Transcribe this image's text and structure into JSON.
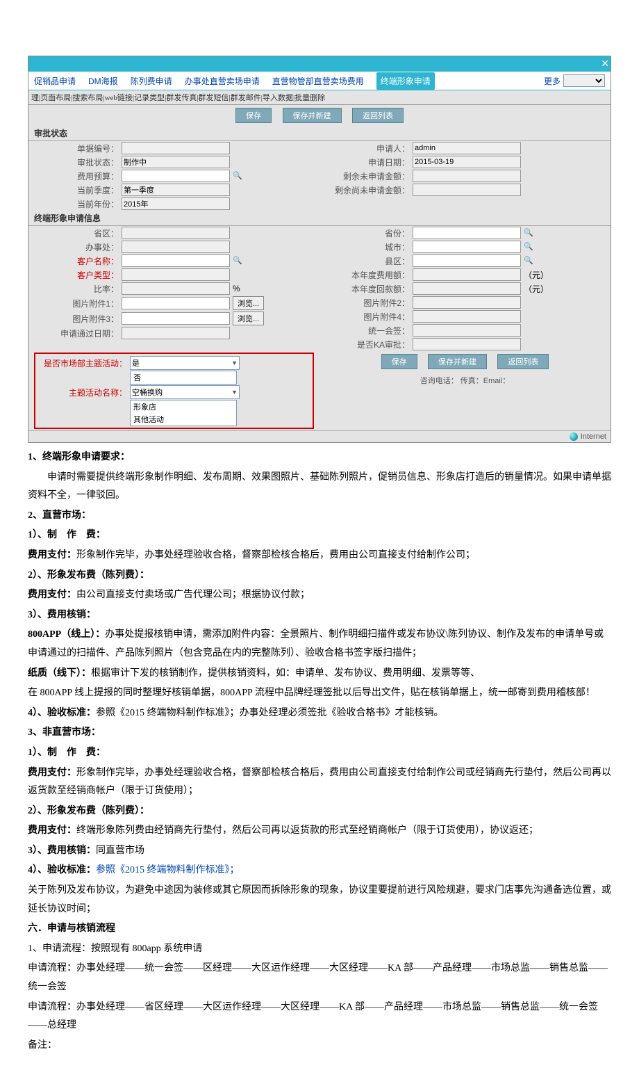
{
  "tabs": {
    "t1": "促销品申请",
    "t2": "DM海报",
    "t3": "陈列费申请",
    "t4": "办事处直营卖场申请",
    "t5": "直营物管部直营卖场费用",
    "t6": "终端形象申请",
    "more": "更多"
  },
  "toolbar": "理|页面布局|搜索布局|web链接|记录类型|群发传真|群发短信|群发邮件|导入数据|批量删除",
  "btns": {
    "save": "保存",
    "saveNew": "保存并新建",
    "back": "返回列表"
  },
  "sec1": "审批状态",
  "sec2": "终端形象申请信息",
  "f": {
    "djbh": "单据编号：",
    "spr": "申请人：",
    "spr_v": "admin",
    "spzt": "审批状态：",
    "spzt_v": "制作中",
    "sqrq": "申请日期：",
    "sqrq_v": "2015-03-19",
    "fyyg": "费用预算：",
    "sywsq": "剩余未申请金额：",
    "dqjd": "当前季度：",
    "dqjd_v": "第一季度",
    "syswsq": "剩余尚未申请金额：",
    "dqnf": "当前年份：",
    "dqnf_v": "2015年",
    "sq": "省区：",
    "sf": "省份：",
    "bsc": "办事处：",
    "cs": "城市：",
    "khmc": "客户名称：",
    "xq": "县区：",
    "khlx": "客户类型：",
    "bnfye": "本年度费用额：",
    "yuan": "（元）",
    "bl": "比率：",
    "pct": "%",
    "bndhk": "本年度回款额：",
    "tp1": "图片附件1：",
    "tp2": "图片附件2：",
    "tp3": "图片附件3：",
    "tp4": "图片附件4：",
    "browse": "浏览...",
    "sqtg": "申请通过日期：",
    "tyhq": "统一会签：",
    "sfka": "是否KA审批：",
    "sfzt": "是否市场部主题活动：",
    "shi": "是",
    "fou": "否",
    "ztmc": "主题活动名称：",
    "opt1": "空桶换购",
    "opt2": "形象店",
    "opt3": "其他活动",
    "footer": "咨询电话：  传真：Email：",
    "ie": "Internet"
  },
  "body": {
    "s1t": "1、终端形象申请要求：",
    "s1p": "申请时需要提供终端形象制作明细、发布周期、效果图照片、基础陈列照片，促销员信息、形象店打造后的销量情况。如果申请单据资料不全，一律驳回。",
    "s2t": "2、直营市场：",
    "s2a": "1）、制　作　费：",
    "s2a_l": "费用支付：",
    "s2a_v": "形象制作完毕，办事处经理验收合格，督察部检核合格后，费用由公司直接支付给制作公司；",
    "s2b": "2）、形象发布费（陈列费）：",
    "s2b_l": "费用支付：",
    "s2b_v": "由公司直接支付卖场或广告代理公司；根据协议付款；",
    "s2c": "3）、费用核销：",
    "s2c_l1": "800APP（线上）：",
    "s2c_v1": "办事处提报核销申请，需添加附件内容：全景照片、制作明细扫描件或发布协议\\陈列协议、制作及发布的申请单号或申请通过的扫描件、产品陈列照片（包含竞品在内的完整陈列）、验收合格书签字版扫描件；",
    "s2c_l2": "纸质（线下）：",
    "s2c_v2": "根据审计下发的核销制作，提供核销资料，如：申请单、发布协议、费用明细、发票等等、",
    "s2c_p3": "在 800APP 线上提报的同时整理好核销单据，800APP 流程中品牌经理签批以后导出文件，贴在核销单据上，统一邮寄到费用稽核部！",
    "s2d": "4）、验收标准：",
    "s2d_v": "参照《2015 终端物料制作标准》；办事处经理必须签批《验收合格书》才能核销。",
    "s3t": "3、非直营市场：",
    "s3a": "1）、制　作　费：",
    "s3a_l": "费用支付：",
    "s3a_v": "形象制作完毕，办事处经理验收合格，督察部检核合格后，费用由公司直接支付给制作公司或经销商先行垫付，然后公司再以返货款至经销商帐户（限于订货使用）；",
    "s3b": "2）、形象发布费（陈列费）：",
    "s3b_l": "费用支付：",
    "s3b_v": "终端形象陈列费由经销商先行垫付，然后公司再以返货款的形式至经销商帐户（限于订货使用），协议返还；",
    "s3c": "3）、费用核销：",
    "s3c_v": "同直营市场",
    "s3d": "4）、验收标准：",
    "s3d_v": "参照《2015 终端物料制作标准》；",
    "s3e": "关于陈列及发布协议，为避免中途因为装修或其它原因而拆除形象的现象，协议里要提前进行风险规避，要求门店事先沟通备选位置，或延长协议时间；",
    "s6t": "六．申请与核销流程",
    "s6a": "1、申请流程：按照现有 800app 系统申请",
    "s6b": "申请流程：办事处经理——统一会签——区经理——大区运作经理——大区经理——KA 部——产品经理——市场总监——销售总监——统一会签",
    "s6c": "申请流程：办事处经理——省区经理——大区运作经理——大区经理——KA 部——产品经理——市场总监——销售总监——统一会签——总经理",
    "s6d": "备注："
  }
}
